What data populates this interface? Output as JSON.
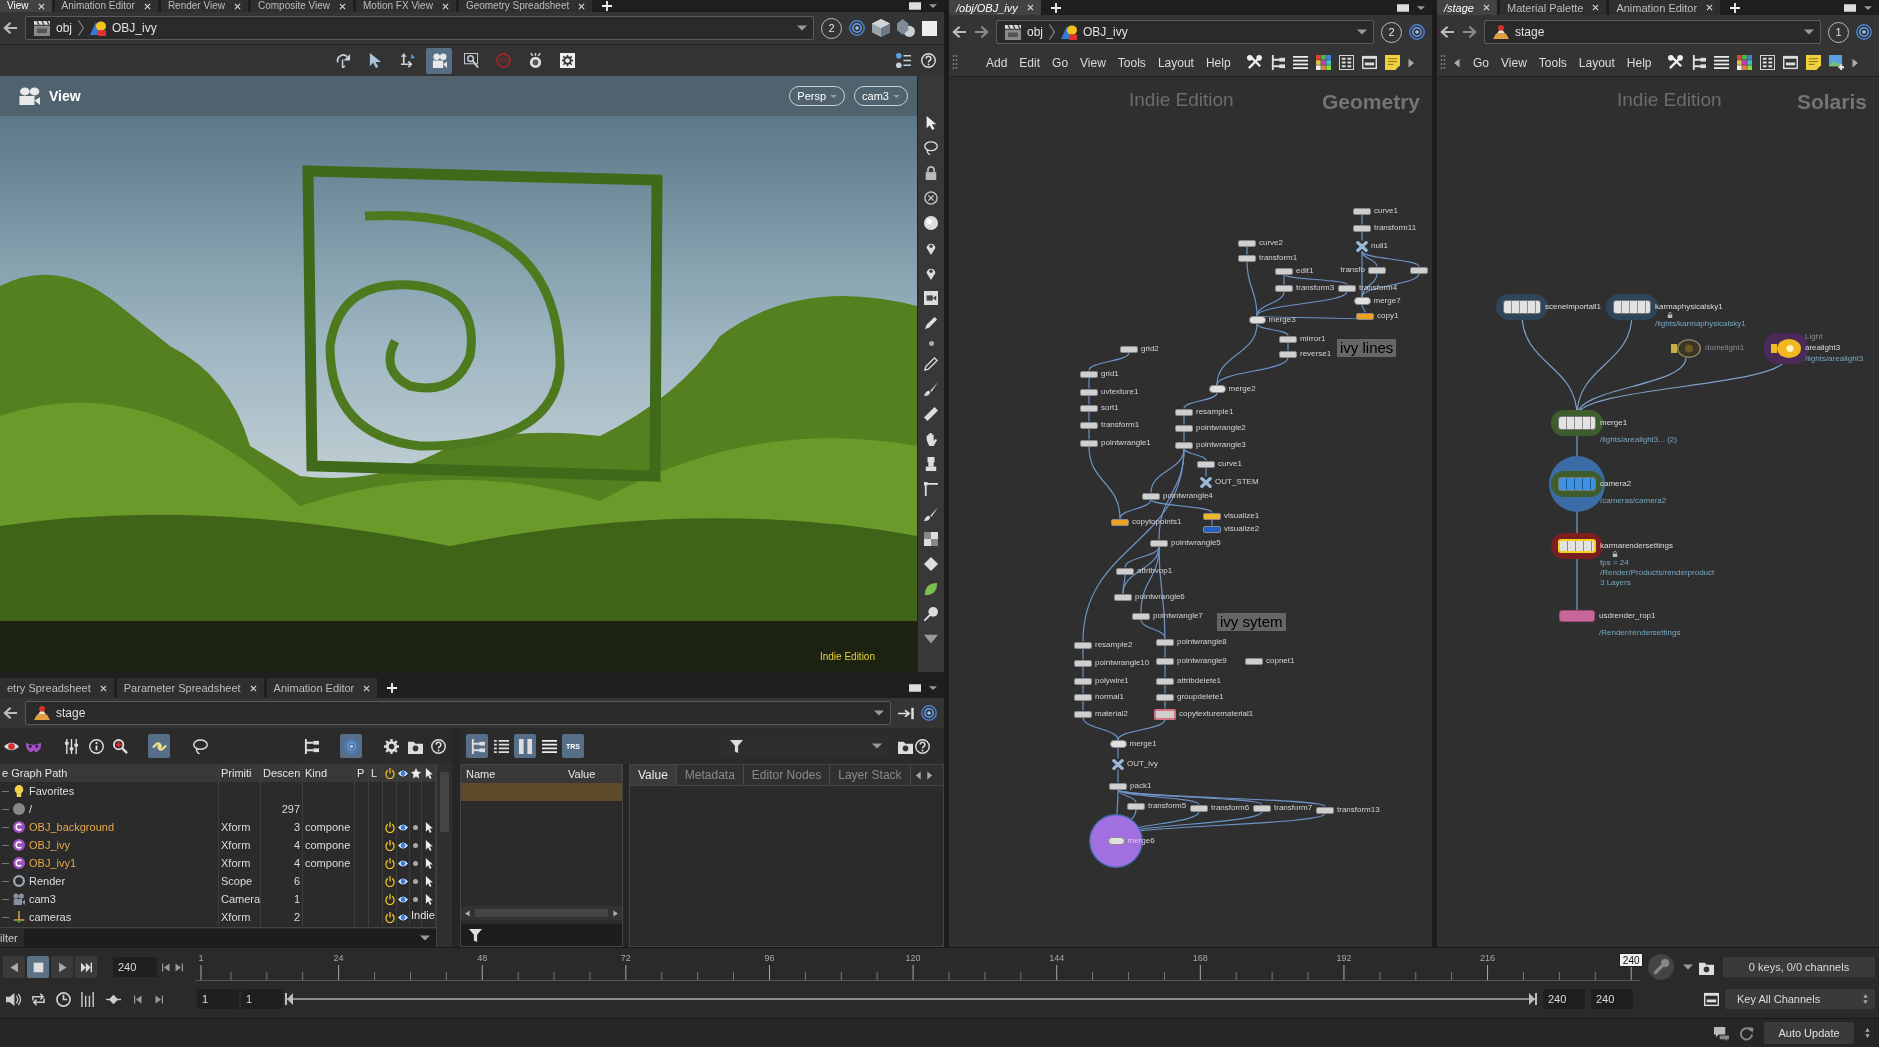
{
  "scene_viewer": {
    "tabs": [
      {
        "label": "View",
        "selected": true
      },
      {
        "label": "Animation Editor",
        "selected": false
      },
      {
        "label": "Render View",
        "selected": false
      },
      {
        "label": "Composite View",
        "selected": false
      },
      {
        "label": "Motion FX View",
        "selected": false
      },
      {
        "label": "Geometry Spreadsheet",
        "selected": false
      }
    ],
    "path": [
      {
        "kind": "obj",
        "label": "obj"
      },
      {
        "kind": "geo",
        "label": "OBJ_ivy"
      }
    ],
    "link_group": "2",
    "tools": [
      {
        "kind": "rotate",
        "selected": false
      },
      {
        "kind": "pointer",
        "selected": false
      },
      {
        "kind": "transform",
        "selected": false
      },
      {
        "kind": "camera",
        "selected": true
      },
      {
        "kind": "zoom",
        "selected": false
      },
      {
        "kind": "noentry",
        "selected": false
      },
      {
        "kind": "flash",
        "selected": false
      },
      {
        "kind": "gearsq",
        "selected": false
      }
    ],
    "viewport": {
      "title": "View",
      "menus": [
        "Persp",
        "cam3"
      ],
      "edition": "Indie Edition"
    }
  },
  "scene_graph": {
    "tabs": [
      {
        "label": "etry Spreadsheet",
        "selected": false
      },
      {
        "label": "Parameter Spreadsheet",
        "selected": false
      },
      {
        "label": "Animation Editor",
        "selected": false
      }
    ],
    "path": [
      {
        "kind": "stage",
        "label": "stage"
      }
    ],
    "tools": [
      {
        "kind": "prims",
        "selected": false
      },
      {
        "kind": "mask",
        "selected": false
      },
      {
        "kind": "sliders",
        "selected": false
      },
      {
        "kind": "info",
        "selected": false
      },
      {
        "kind": "magnifier",
        "selected": false
      },
      {
        "kind": "link",
        "selected": true
      },
      {
        "kind": "lasso",
        "selected": false
      },
      {
        "kind": "hierarchy",
        "selected": false
      },
      {
        "kind": "target",
        "selected": true
      },
      {
        "kind": "gear",
        "selected": false
      },
      {
        "kind": "camfolder",
        "selected": false
      },
      {
        "kind": "help",
        "selected": false
      }
    ],
    "columns": [
      "e Graph Path",
      "Primiti",
      "Descen",
      "Kind",
      "P",
      "L"
    ],
    "rows": [
      {
        "kind": "favorites",
        "name": "Favorites"
      },
      {
        "kind": "root",
        "name": "/",
        "descendants": "297"
      },
      {
        "kind": "component",
        "name": "OBJ_background",
        "type": "Xform",
        "descendants": "3",
        "prim_kind": "compone",
        "active": true,
        "visible": true
      },
      {
        "kind": "component",
        "name": "OBJ_ivy",
        "type": "Xform",
        "descendants": "4",
        "prim_kind": "compone",
        "active": true,
        "visible": true
      },
      {
        "kind": "component",
        "name": "OBJ_ivy1",
        "type": "Xform",
        "descendants": "4",
        "prim_kind": "compone",
        "active": true,
        "visible": true
      },
      {
        "kind": "scope",
        "name": "Render",
        "type": "Scope",
        "descendants": "6",
        "active": true,
        "visible": true
      },
      {
        "kind": "camera",
        "name": "cam3",
        "type": "Camera",
        "descendants": "1",
        "active": true,
        "visible": true
      },
      {
        "kind": "xform",
        "name": "cameras",
        "type": "Xform",
        "descendants": "2",
        "active": true,
        "visible": true
      }
    ],
    "watermark": "Indie",
    "filter_label": "ilter"
  },
  "attributes": {
    "tools": [
      {
        "kind": "tree",
        "selected": true
      },
      {
        "kind": "list",
        "selected": false
      },
      {
        "kind": "columns",
        "selected": true
      },
      {
        "kind": "lines",
        "selected": false
      },
      {
        "kind": "trs",
        "label": "TRS",
        "selected": true
      }
    ],
    "columns": [
      "Name",
      "Value"
    ],
    "rows": [
      {
        "selected": true
      }
    ],
    "inspector_tabs": [
      {
        "label": "Value",
        "selected": true
      },
      {
        "label": "Metadata",
        "selected": false
      },
      {
        "label": "Editor Nodes",
        "selected": false
      },
      {
        "label": "Layer Stack",
        "selected": false
      }
    ]
  },
  "geometry_network": {
    "tabs": [
      {
        "label": "/obj/OBJ_ivy",
        "selected": true
      }
    ],
    "path": [
      {
        "kind": "obj",
        "label": "obj"
      },
      {
        "kind": "geo",
        "label": "OBJ_ivy"
      }
    ],
    "link_group": "2",
    "menu": [
      "Add",
      "Edit",
      "Go",
      "View",
      "Tools",
      "Layout",
      "Help"
    ],
    "edition": "Indie Edition",
    "context": "Geometry",
    "notes": [
      "ivy lines",
      "ivy sytem"
    ],
    "nodes": [
      {
        "kind": "sop",
        "label": "curve1",
        "template": false,
        "display": false
      },
      {
        "kind": "sop",
        "label": "transform11",
        "template": false,
        "display": false
      },
      {
        "kind": "null",
        "label": "null1",
        "template": false,
        "display": false
      },
      {
        "kind": "sop",
        "label": "transfo",
        "template": false,
        "display": false
      },
      {
        "kind": "sop",
        "template": false,
        "display": false
      },
      {
        "kind": "merge",
        "label": "merge7",
        "template": false,
        "display": false
      },
      {
        "kind": "sop",
        "label": "copy1",
        "color": "#f0a020",
        "template": false,
        "display": false
      },
      {
        "kind": "sop",
        "label": "curve2",
        "template": false,
        "display": false
      },
      {
        "kind": "sop",
        "label": "transform1",
        "template": false,
        "display": false
      },
      {
        "kind": "sop",
        "label": "edit1",
        "template": false,
        "display": false
      },
      {
        "kind": "sop",
        "label": "transform3",
        "template": false,
        "display": false
      },
      {
        "kind": "sop",
        "label": "transform4",
        "template": false,
        "display": false
      },
      {
        "kind": "merge",
        "label": "merge3",
        "template": false,
        "display": false
      },
      {
        "kind": "sop",
        "label": "mirror1",
        "template": false,
        "display": false
      },
      {
        "kind": "sop",
        "label": "reverse1",
        "template": false,
        "display": false
      },
      {
        "kind": "merge",
        "label": "merge2",
        "template": false,
        "display": false
      },
      {
        "kind": "sop",
        "label": "resample1",
        "template": false,
        "display": false
      },
      {
        "kind": "sop",
        "label": "pointwrangle2",
        "template": false,
        "display": false
      },
      {
        "kind": "sop",
        "label": "pointwrangle3",
        "template": false,
        "display": false
      },
      {
        "kind": "sop",
        "label": "curve1",
        "template": false,
        "display": false
      },
      {
        "kind": "null",
        "label": "OUT_STEM",
        "template": false,
        "display": false
      },
      {
        "kind": "sop",
        "label": "grid2",
        "template": false,
        "display": false
      },
      {
        "kind": "sop",
        "label": "grid1",
        "template": false,
        "display": false
      },
      {
        "kind": "sop",
        "label": "uvtexture1",
        "template": false,
        "display": false
      },
      {
        "kind": "sop",
        "label": "sort1",
        "template": false,
        "display": false
      },
      {
        "kind": "sop",
        "label": "transform1",
        "template": false,
        "display": false
      },
      {
        "kind": "sop",
        "label": "pointwrangle1",
        "template": false,
        "display": false
      },
      {
        "kind": "sop",
        "label": "pointwrangle4",
        "template": false,
        "display": false
      },
      {
        "kind": "sop",
        "label": "copytopoints1",
        "color": "#f0a020",
        "template": false,
        "display": false
      },
      {
        "kind": "sop",
        "label": "visualize1",
        "color": "#f0b824",
        "template": false,
        "display": false
      },
      {
        "kind": "sop",
        "label": "visualize2",
        "color": "#2262c4",
        "template": false,
        "display": false
      },
      {
        "kind": "sop",
        "label": "pointwrangle5",
        "template": false,
        "display": false
      },
      {
        "kind": "sop",
        "label": "attribvop1",
        "template": false,
        "display": false
      },
      {
        "kind": "sop",
        "label": "pointwrangle6",
        "template": false,
        "display": false
      },
      {
        "kind": "sop",
        "label": "pointwrangle7",
        "template": false,
        "display": false
      },
      {
        "kind": "sop",
        "label": "pointwrangle8",
        "template": false,
        "display": false
      },
      {
        "kind": "sop",
        "label": "pointwrangle9",
        "template": false,
        "display": false
      },
      {
        "kind": "sop",
        "label": "resample2",
        "template": false,
        "display": false
      },
      {
        "kind": "sop",
        "label": "pointwrangle10",
        "template": false,
        "display": false
      },
      {
        "kind": "sop",
        "label": "polywire1",
        "template": false,
        "display": false
      },
      {
        "kind": "sop",
        "label": "normal1",
        "template": false,
        "display": false
      },
      {
        "kind": "sop",
        "label": "material2",
        "template": false,
        "display": false
      },
      {
        "kind": "sop",
        "label": "attribdelete1",
        "template": false,
        "display": false
      },
      {
        "kind": "sop",
        "label": "groupdelete1",
        "template": false,
        "display": false
      },
      {
        "kind": "sop",
        "label": "copytexturematerial1",
        "template": true,
        "display": false
      },
      {
        "kind": "sop",
        "label": "copnet1",
        "template": false,
        "display": false
      },
      {
        "kind": "merge",
        "label": "merge1",
        "template": false,
        "display": false
      },
      {
        "kind": "null",
        "label": "OUT_ivy",
        "template": false,
        "display": false
      },
      {
        "kind": "sop",
        "label": "pack1",
        "template": false,
        "display": false
      },
      {
        "kind": "sop",
        "label": "transform5",
        "template": false,
        "display": false
      },
      {
        "kind": "sop",
        "label": "transform6",
        "template": false,
        "display": false
      },
      {
        "kind": "sop",
        "label": "transform7",
        "template": false,
        "display": false
      },
      {
        "kind": "sop",
        "label": "transform13",
        "template": false,
        "display": false
      },
      {
        "kind": "merge",
        "label": "merge6",
        "template": false,
        "display": true
      }
    ]
  },
  "stage_network": {
    "tabs": [
      {
        "label": "/stage",
        "selected": true
      },
      {
        "label": "Material Palette",
        "selected": false
      },
      {
        "label": "Animation Editor",
        "selected": false
      }
    ],
    "path": [
      {
        "kind": "stage",
        "label": "stage"
      }
    ],
    "link_group": "1",
    "menu": [
      "Go",
      "View",
      "Tools",
      "Layout",
      "Help"
    ],
    "edition": "Indie Edition",
    "context": "Solaris",
    "nodes": [
      {
        "kind": "lop",
        "label": "sceneimportall1",
        "color": "#2d4459",
        "selected": false,
        "disabled": false,
        "display": false,
        "locked": false
      },
      {
        "kind": "lop",
        "label": "karmaphysicalsky1",
        "color": "#2d4459",
        "selected": false,
        "disabled": false,
        "display": false,
        "locked": true,
        "info": [
          "/lights/karmaphysicalsky1"
        ]
      },
      {
        "kind": "light",
        "label": "domelight1",
        "selected": false,
        "disabled": true,
        "display": false,
        "locked": false
      },
      {
        "kind": "light",
        "label": "arealight3",
        "caption": "Light",
        "color": "#4a2a58",
        "selected": false,
        "disabled": false,
        "display": false,
        "locked": false,
        "info": [
          "/lights/arealight3"
        ]
      },
      {
        "kind": "lop",
        "label": "merge1",
        "color": "#3d5e2c",
        "selected": false,
        "disabled": false,
        "display": false,
        "locked": false,
        "info": [
          "/lights/arealight3... (2)"
        ]
      },
      {
        "kind": "camera",
        "label": "camera2",
        "color": "#3d5e2c",
        "selected": false,
        "disabled": false,
        "display": true,
        "locked": false,
        "info": [
          "/cameras/camera2"
        ]
      },
      {
        "kind": "lop",
        "label": "karmarendersettings",
        "color": "#7a1e22",
        "selected": true,
        "disabled": false,
        "display": false,
        "locked": true,
        "info": [
          "fps = 24",
          "/Render/Products/renderproduct",
          "3 Layers"
        ]
      },
      {
        "kind": "rop",
        "label": "usdrender_rop1",
        "selected": false,
        "disabled": false,
        "display": false,
        "locked": false,
        "info": [
          "/Render/rendersettings"
        ]
      }
    ]
  },
  "timeline": {
    "transport": [
      {
        "kind": "reverse",
        "selected": false
      },
      {
        "kind": "stop",
        "selected": true
      },
      {
        "kind": "play",
        "selected": false
      },
      {
        "kind": "end",
        "selected": false
      }
    ],
    "frame": "240",
    "ticks": [
      "1",
      "24",
      "48",
      "72",
      "96",
      "120",
      "144",
      "168",
      "192",
      "216"
    ],
    "current": "240",
    "keys": "0 keys, 0/0 channels",
    "range": {
      "global_start": "1",
      "start": "1",
      "end": "240",
      "global_end": "240"
    },
    "range_slider": {
      "level": 1
    },
    "key_button": "Key All Channels"
  },
  "status_bar": {
    "update_mode": "Auto Update"
  }
}
